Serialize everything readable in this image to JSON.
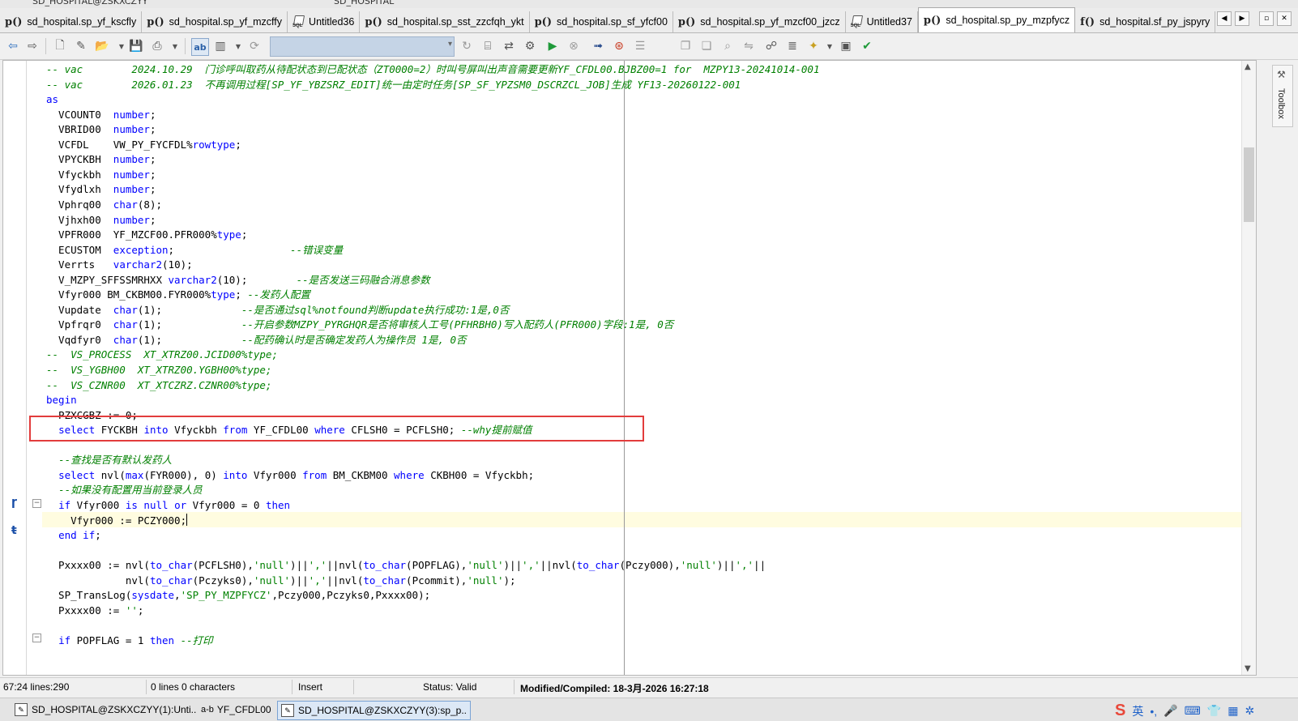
{
  "window": {
    "title_fragment": "SD_HOSPITAL@ZSKXCZYY",
    "title_fragment2": "SD_HOSPITAL"
  },
  "tabs": [
    {
      "icon": "p()",
      "label": "sd_hospital.sp_yf_kscfly",
      "active": false
    },
    {
      "icon": "p()",
      "label": "sd_hospital.sp_yf_mzcffy",
      "active": false
    },
    {
      "icon": "sql",
      "label": "Untitled36",
      "active": false
    },
    {
      "icon": "p()",
      "label": "sd_hospital.sp_sst_zzcfqh_ykt",
      "active": false
    },
    {
      "icon": "p()",
      "label": "sd_hospital.sp_sf_yfcf00",
      "active": false
    },
    {
      "icon": "p()",
      "label": "sd_hospital.sp_yf_mzcf00_jzcz",
      "active": false
    },
    {
      "icon": "sql",
      "label": "Untitled37",
      "active": false
    },
    {
      "icon": "p()",
      "label": "sd_hospital.sp_py_mzpfycz",
      "active": true
    },
    {
      "icon": "f()",
      "label": "sd_hospital.sf_py_jspyry",
      "active": false
    }
  ],
  "code_lines": [
    [
      [
        "cm",
        "-- vac        2024.10.29  门诊呼叫取药从待配状态到已配状态（ZT0000=2）时叫号屏叫出声音需要更新YF_CFDL00.BJBZ00=1 for  MZPY13-20241014-001"
      ]
    ],
    [
      [
        "cm",
        "-- vac        2026.01.23  不再调用过程[SP_YF_YBZSRZ_EDIT]统一由定时任务[SP_SF_YPZSM0_DSCRZCL_JOB]生成 YF13-20260122-001"
      ]
    ],
    [
      [
        "kw",
        "as"
      ]
    ],
    [
      [
        "",
        "  VCOUNT0  "
      ],
      [
        "kw",
        "number"
      ],
      [
        "",
        ";"
      ]
    ],
    [
      [
        "",
        "  VBRID00  "
      ],
      [
        "kw",
        "number"
      ],
      [
        "",
        ";"
      ]
    ],
    [
      [
        "",
        "  VCFDL    VW_PY_FYCFDL%"
      ],
      [
        "kw",
        "rowtype"
      ],
      [
        "",
        ";"
      ]
    ],
    [
      [
        "",
        "  VPYCKBH  "
      ],
      [
        "kw",
        "number"
      ],
      [
        "",
        ";"
      ]
    ],
    [
      [
        "",
        "  Vfyckbh  "
      ],
      [
        "kw",
        "number"
      ],
      [
        "",
        ";"
      ]
    ],
    [
      [
        "",
        "  Vfydlxh  "
      ],
      [
        "kw",
        "number"
      ],
      [
        "",
        ";"
      ]
    ],
    [
      [
        "",
        "  Vphrq00  "
      ],
      [
        "kw",
        "char"
      ],
      [
        "",
        "(8);"
      ]
    ],
    [
      [
        "",
        "  Vjhxh00  "
      ],
      [
        "kw",
        "number"
      ],
      [
        "",
        ";"
      ]
    ],
    [
      [
        "",
        "  VPFR000  YF_MZCF00.PFR000%"
      ],
      [
        "kw",
        "type"
      ],
      [
        "",
        ";"
      ]
    ],
    [
      [
        "",
        "  ECUSTOM  "
      ],
      [
        "kw",
        "exception"
      ],
      [
        "",
        ";                   "
      ],
      [
        "cm",
        "--错误变量"
      ]
    ],
    [
      [
        "",
        "  Verrts   "
      ],
      [
        "kw",
        "varchar2"
      ],
      [
        "",
        "(10);"
      ]
    ],
    [
      [
        "",
        "  V_MZPY_SFFSSMRHXX "
      ],
      [
        "kw",
        "varchar2"
      ],
      [
        "",
        "(10);        "
      ],
      [
        "cm",
        "--是否发送三码融合消息参数"
      ]
    ],
    [
      [
        "",
        "  Vfyr000 BM_CKBM00.FYR000%"
      ],
      [
        "kw",
        "type"
      ],
      [
        "",
        "; "
      ],
      [
        "cm",
        "--发药人配置"
      ]
    ],
    [
      [
        "",
        "  Vupdate  "
      ],
      [
        "kw",
        "char"
      ],
      [
        "",
        "(1);             "
      ],
      [
        "cm",
        "--是否通过sql%notfound判断update执行成功:1是,0否"
      ]
    ],
    [
      [
        "",
        "  Vpfrqr0  "
      ],
      [
        "kw",
        "char"
      ],
      [
        "",
        "(1);             "
      ],
      [
        "cm",
        "--开启参数MZPY_PYRGHQR是否将审核人工号(PFHRBH0)写入配药人(PFR000)字段:1是, 0否"
      ]
    ],
    [
      [
        "",
        "  Vqdfyr0  "
      ],
      [
        "kw",
        "char"
      ],
      [
        "",
        "(1);             "
      ],
      [
        "cm",
        "--配药确认时是否确定发药人为操作员 1是, 0否"
      ]
    ],
    [
      [
        "cm",
        "--  VS_PROCESS  XT_XTRZ00.JCID00%type;"
      ]
    ],
    [
      [
        "cm",
        "--  VS_YGBH00  XT_XTRZ00.YGBH00%type;"
      ]
    ],
    [
      [
        "cm",
        "--  VS_CZNR00  XT_XTCZRZ.CZNR00%type;"
      ]
    ],
    [
      [
        "kw",
        "begin"
      ]
    ],
    [
      [
        "",
        "  PZXCGBZ := 0;"
      ]
    ],
    [
      [
        "",
        "  "
      ],
      [
        "kw",
        "select"
      ],
      [
        "",
        " FYCKBH "
      ],
      [
        "kw",
        "into"
      ],
      [
        "",
        " Vfyckbh "
      ],
      [
        "kw",
        "from"
      ],
      [
        "",
        " YF_CFDL00 "
      ],
      [
        "kw",
        "where"
      ],
      [
        "",
        " CFLSH0 = PCFLSH0; "
      ],
      [
        "cm",
        "--why提前赋值"
      ]
    ],
    [
      [
        "",
        ""
      ]
    ],
    [
      [
        "",
        "  "
      ],
      [
        "cm",
        "--查找是否有默认发药人"
      ]
    ],
    [
      [
        "",
        "  "
      ],
      [
        "kw",
        "select"
      ],
      [
        "",
        " nvl("
      ],
      [
        "kw",
        "max"
      ],
      [
        "",
        "(FYR000), 0) "
      ],
      [
        "kw",
        "into"
      ],
      [
        "",
        " Vfyr000 "
      ],
      [
        "kw",
        "from"
      ],
      [
        "",
        " BM_CKBM00 "
      ],
      [
        "kw",
        "where"
      ],
      [
        "",
        " CKBH00 = Vfyckbh;"
      ]
    ],
    [
      [
        "",
        "  "
      ],
      [
        "cm",
        "--如果没有配置用当前登录人员"
      ]
    ],
    [
      [
        "",
        "  "
      ],
      [
        "kw",
        "if"
      ],
      [
        "",
        " Vfyr000 "
      ],
      [
        "kw",
        "is null or"
      ],
      [
        "",
        " Vfyr000 = 0 "
      ],
      [
        "kw",
        "then"
      ]
    ],
    [
      [
        "",
        "    Vfyr000 := PCZY000;"
      ],
      [
        "caret",
        ""
      ]
    ],
    [
      [
        "",
        "  "
      ],
      [
        "kw",
        "end if"
      ],
      [
        "",
        ";"
      ]
    ],
    [
      [
        "",
        ""
      ]
    ],
    [
      [
        "",
        "  Pxxxx00 := nvl("
      ],
      [
        "kw",
        "to_char"
      ],
      [
        "",
        "(PCFLSH0),"
      ],
      [
        "str",
        "'null'"
      ],
      [
        "",
        ")||"
      ],
      [
        "str",
        "','"
      ],
      [
        "",
        "||nvl("
      ],
      [
        "kw",
        "to_char"
      ],
      [
        "",
        "(POPFLAG),"
      ],
      [
        "str",
        "'null'"
      ],
      [
        "",
        ")||"
      ],
      [
        "str",
        "','"
      ],
      [
        "",
        "||nvl("
      ],
      [
        "kw",
        "to_char"
      ],
      [
        "",
        "(Pczy000),"
      ],
      [
        "str",
        "'null'"
      ],
      [
        "",
        ")||"
      ],
      [
        "str",
        "','"
      ],
      [
        "",
        "||"
      ]
    ],
    [
      [
        "",
        "             nvl("
      ],
      [
        "kw",
        "to_char"
      ],
      [
        "",
        "(Pczyks0),"
      ],
      [
        "str",
        "'null'"
      ],
      [
        "",
        ")||"
      ],
      [
        "str",
        "','"
      ],
      [
        "",
        "||nvl("
      ],
      [
        "kw",
        "to_char"
      ],
      [
        "",
        "(Pcommit),"
      ],
      [
        "str",
        "'null'"
      ],
      [
        "",
        ");"
      ]
    ],
    [
      [
        "",
        "  SP_TransLog("
      ],
      [
        "kw",
        "sysdate"
      ],
      [
        "",
        ","
      ],
      [
        "str",
        "'SP_PY_MZPFYCZ'"
      ],
      [
        "",
        ",Pczy000,Pczyks0,Pxxxx00);"
      ]
    ],
    [
      [
        "",
        "  Pxxxx00 := "
      ],
      [
        "str",
        "''"
      ],
      [
        "",
        ";"
      ]
    ],
    [
      [
        "",
        ""
      ]
    ],
    [
      [
        "",
        "  "
      ],
      [
        "kw",
        "if"
      ],
      [
        "",
        " POPFLAG = 1 "
      ],
      [
        "kw",
        "then"
      ],
      [
        "",
        " "
      ],
      [
        "cm",
        "--打印"
      ]
    ]
  ],
  "current_line_index": 30,
  "highlighted_line_index": 24,
  "toolbox_label": "Toolbox",
  "status": {
    "position": "67:24 lines:290",
    "selection": "0 lines 0 characters",
    "mode": "Insert",
    "state": "Status: Valid",
    "modified": "Modified/Compiled: 18-3月-2026 16:27:18"
  },
  "taskbar": [
    {
      "label": "SD_HOSPITAL@ZSKXCZYY(1):Unti..",
      "active": false
    },
    {
      "label": "YF_CFDL00",
      "active": false,
      "prefix": "a-b"
    },
    {
      "label": "SD_HOSPITAL@ZSKXCZYY(3):sp_p..",
      "active": true
    }
  ],
  "tray": {
    "ime_label": "英"
  },
  "colors": {
    "keyword": "#0000ff",
    "comment": "#008000",
    "highlight_box": "#e23c3c",
    "current_line": "#fffce0"
  }
}
